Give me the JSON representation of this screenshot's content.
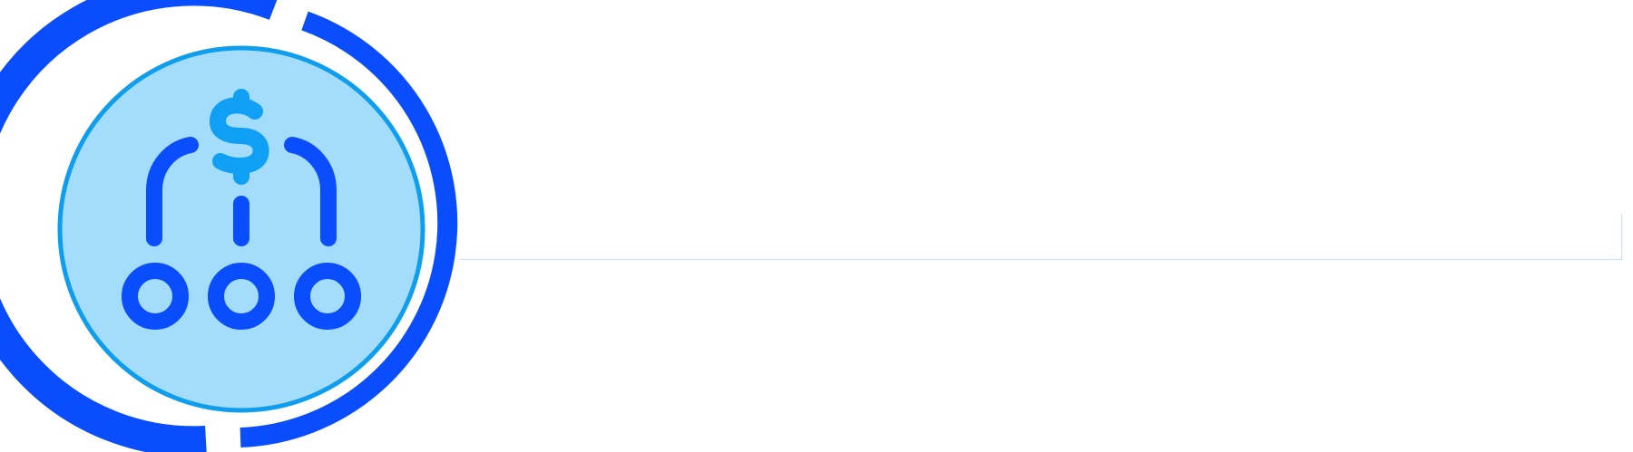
{
  "emblem": {
    "icon": "money-distribution-icon",
    "colors": {
      "outer_ring": "#0a4dfc",
      "inner_ring": "#0f9ded",
      "disc_fill": "#a4dcfc",
      "dollar_sign": "#0fa0f5",
      "network": "#0a4dfc"
    }
  },
  "connector": {
    "color": "#cfe0ff"
  }
}
